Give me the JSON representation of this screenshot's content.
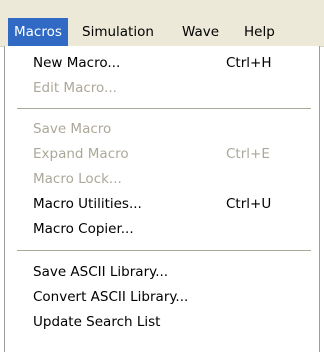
{
  "menubar": {
    "items": [
      {
        "label": "Macros"
      },
      {
        "label": "Simulation"
      },
      {
        "label": "Wave"
      },
      {
        "label": "Help"
      }
    ]
  },
  "dropdown": {
    "groups": [
      [
        {
          "label": "New Macro...",
          "shortcut": "Ctrl+H",
          "enabled": true
        },
        {
          "label": "Edit Macro...",
          "shortcut": "",
          "enabled": false
        }
      ],
      [
        {
          "label": "Save Macro",
          "shortcut": "",
          "enabled": false
        },
        {
          "label": "Expand Macro",
          "shortcut": "Ctrl+E",
          "enabled": false
        },
        {
          "label": "Macro Lock...",
          "shortcut": "",
          "enabled": false
        },
        {
          "label": "Macro Utilities...",
          "shortcut": "Ctrl+U",
          "enabled": true
        },
        {
          "label": "Macro Copier...",
          "shortcut": "",
          "enabled": true
        }
      ],
      [
        {
          "label": "Save ASCII Library...",
          "shortcut": "",
          "enabled": true
        },
        {
          "label": "Convert ASCII Library...",
          "shortcut": "",
          "enabled": true
        },
        {
          "label": "Update Search List",
          "shortcut": "",
          "enabled": true
        }
      ]
    ]
  },
  "colors": {
    "menubar_bg": "#ece9d8",
    "highlight": "#316ac5",
    "disabled_text": "#aca899"
  }
}
